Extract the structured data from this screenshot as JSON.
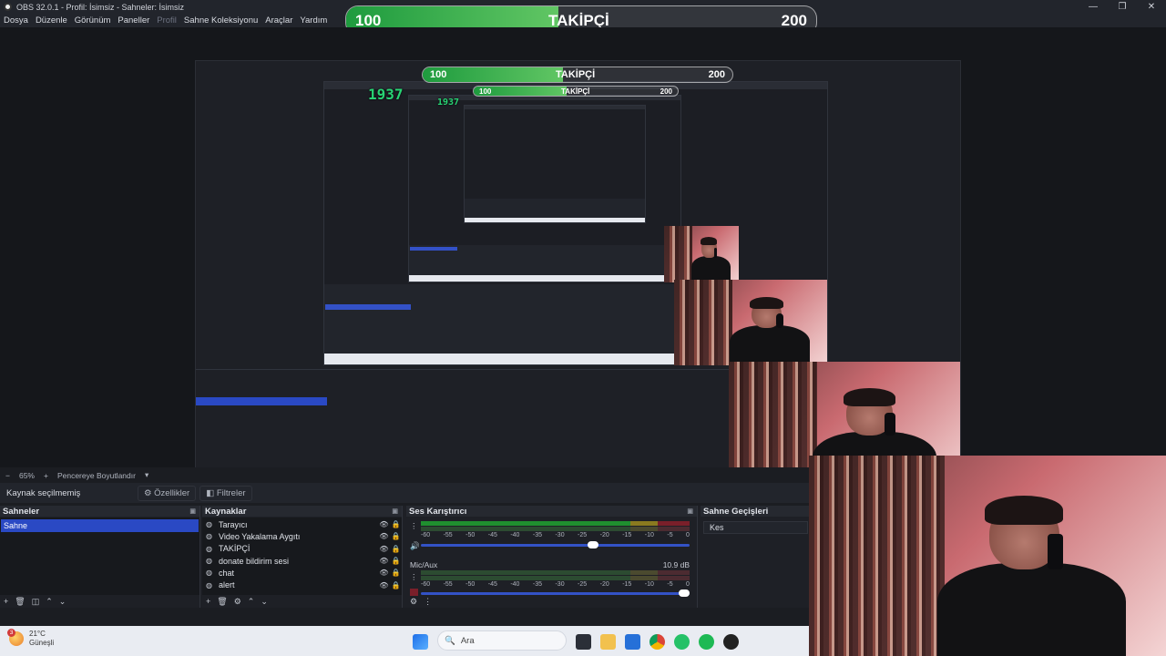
{
  "window": {
    "title": "OBS 32.0.1 - Profil: İsimsiz - Sahneler: İsimsiz",
    "controls": [
      "—",
      "❐",
      "✕"
    ]
  },
  "menu": {
    "items": [
      "Dosya",
      "Düzenle",
      "Görünüm",
      "Paneller",
      "Profil",
      "Sahne Koleksiyonu",
      "Araçlar",
      "Yardım"
    ]
  },
  "follower_goal": {
    "start": "100",
    "label": "TAKİPÇİ",
    "goal": "200",
    "progress": 0.45
  },
  "nested_counter": "1937",
  "preview_controls": {
    "minus": "−",
    "zoom": "65%",
    "plus": "+",
    "fit_label": "Pencereye Boyutlandır"
  },
  "source_bar": {
    "status": "Kaynak seçilmemiş",
    "properties": "Özellikler",
    "filters": "Filtreler"
  },
  "scenes": {
    "title": "Sahneler",
    "items": [
      "Sahne"
    ],
    "footer": [
      "+",
      "🗑",
      "◫",
      "⌃",
      "⌄"
    ]
  },
  "sources": {
    "title": "Kaynaklar",
    "items": [
      {
        "icon": "browser-icon",
        "glyph": "◍",
        "name": "Tarayıcı"
      },
      {
        "icon": "video-capture-icon",
        "glyph": "◍",
        "name": "Video Yakalama Aygıtı"
      },
      {
        "icon": "text-icon",
        "glyph": "◍",
        "name": "TAKİPÇİ"
      },
      {
        "icon": "browser-icon",
        "glyph": "◍",
        "name": "donate bildirim sesi"
      },
      {
        "icon": "browser-icon",
        "glyph": "◍",
        "name": "chat"
      },
      {
        "icon": "browser-icon",
        "glyph": "◍",
        "name": "alert"
      }
    ],
    "footer": [
      "+",
      "🗑",
      "⚙",
      "⌃",
      "⌄"
    ]
  },
  "mixer": {
    "title": "Ses Karıştırıcı",
    "ticks": [
      "-60",
      "-55",
      "-50",
      "-45",
      "-40",
      "-35",
      "-30",
      "-25",
      "-20",
      "-15",
      "-10",
      "-5",
      "0"
    ],
    "channels": [
      {
        "name": "",
        "db": "",
        "level": 0.62
      },
      {
        "name": "Mic/Aux",
        "db": "10.9 dB",
        "level": 0.03
      }
    ],
    "footer": [
      "⚙",
      "⋮"
    ]
  },
  "transitions": {
    "title": "Sahne Geçişleri",
    "items": [
      "Kes"
    ]
  },
  "taskbar": {
    "weather_badge": "3",
    "temp": "21°C",
    "condition": "Güneşli",
    "search_placeholder": "Ara"
  }
}
